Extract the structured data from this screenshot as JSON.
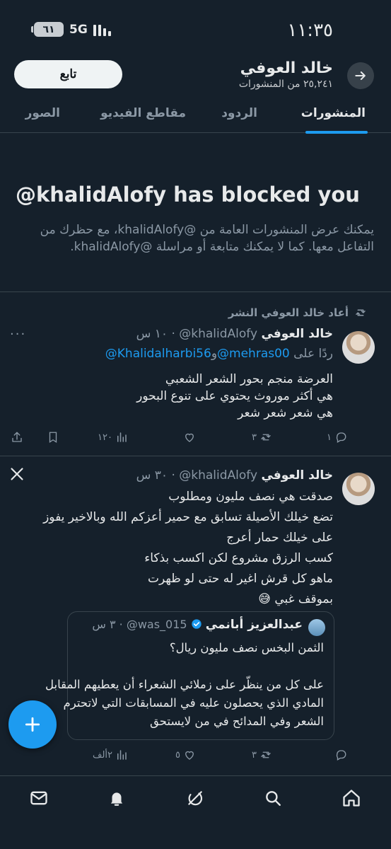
{
  "status_bar": {
    "time": "١١:٣٥",
    "battery": "٦١",
    "network": "5G"
  },
  "header": {
    "name": "خالد العوفي",
    "post_count": "٢٥,٢٤١ من المنشورات",
    "follow_label": "تابع"
  },
  "tabs": [
    {
      "label": "المنشورات",
      "active": true
    },
    {
      "label": "الردود",
      "active": false
    },
    {
      "label": "مقاطع الفيديو",
      "active": false
    },
    {
      "label": "الصور",
      "active": false
    }
  ],
  "blocked": {
    "title": "@khalidAlofy has blocked you",
    "description_line1": "يمكنك عرض المنشورات العامة من @khalidAlofy، مع حظرك من",
    "description_line2": "التفاعل معها. كما لا يمكنك متابعة أو مراسلة @khalidAlofy."
  },
  "tweet1": {
    "repost_label": "أعاد خالد العوفي النشر",
    "name": "خالد العوفي",
    "handle": "@khalidAlofy",
    "time": "١٠ س",
    "reply_prefix": "ردًا على",
    "reply_to_1": "@mehras00",
    "reply_and": "و",
    "reply_to_2": "@Khalidalharbi56",
    "lines": [
      "العرضة منجم بحور الشعر الشعبي",
      "هي أكثر موروث يحتوي على تنوع البحور",
      "هي شعر شعر شعر"
    ],
    "replies": "١",
    "reposts": "٣",
    "likes": "",
    "views": "١٢٠"
  },
  "tweet2": {
    "name": "خالد العوفي",
    "handle": "@khalidAlofy",
    "time": "٣٠ س",
    "lines": [
      "صدقت هي نصف مليون ومطلوب",
      "تضع خيلك الأصيلة تسابق مع حمير أعزكم الله وبالاخير يفوز",
      "على خيلك حمار أعرج",
      "كسب الرزق مشروع  لكن اكسب بذكاء",
      "ماهو كل قرش اغير له حتى لو ظهرت",
      "بموقف غبي"
    ],
    "emoji": "😅",
    "quote": {
      "name": "عبدالعزيز أبانمي",
      "handle": "@was_015",
      "time": "٣ س",
      "lines": [
        "الثمن البخس نصف مليون ريال؟",
        "",
        "على كل من ينظّر على زملائي الشعراء أن يعطيهم المقابل",
        "المادي الذي يحصلون عليه في المسابقات التي لاتحترم",
        "الشعر وفي المدائح في من لايستحق"
      ]
    },
    "replies": "",
    "reposts": "٣",
    "likes": "٥",
    "views": "٢ألف"
  }
}
